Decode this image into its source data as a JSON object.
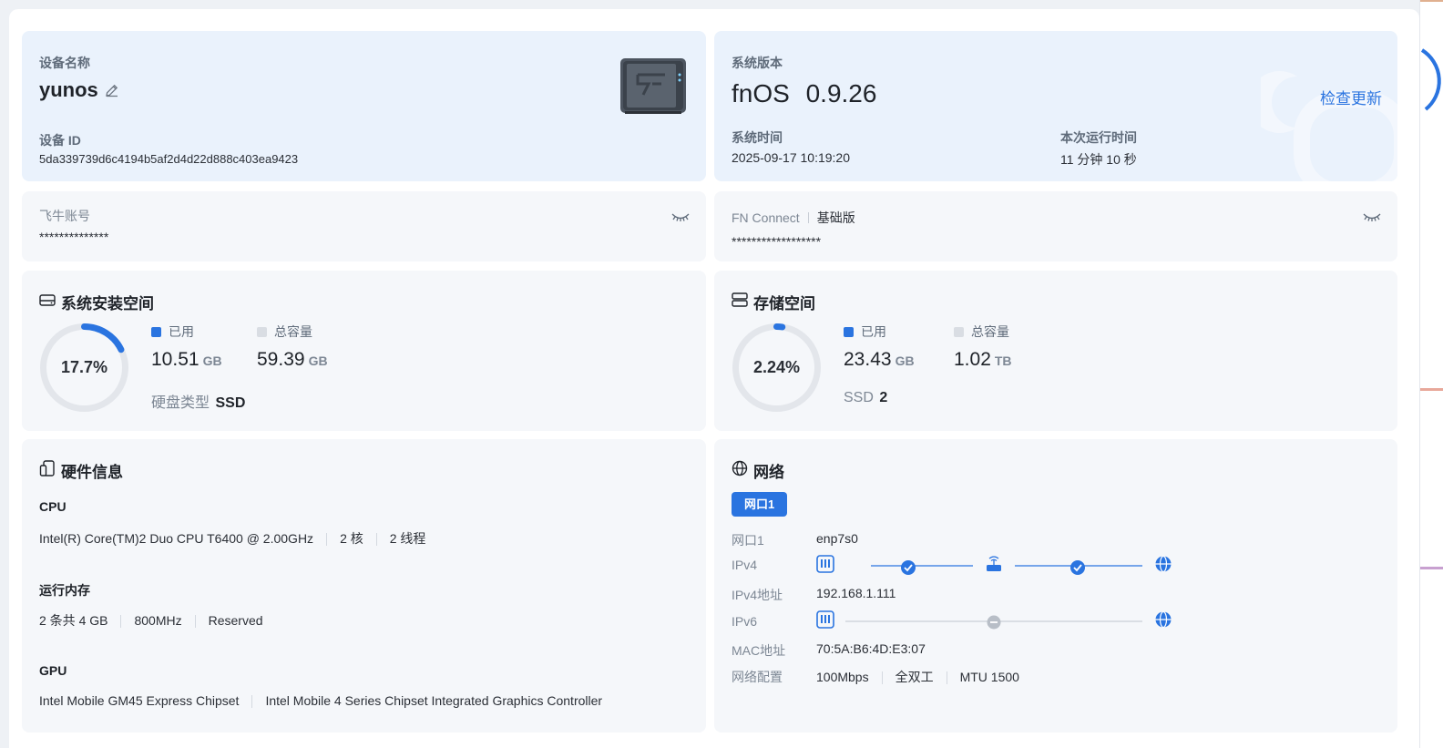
{
  "device": {
    "name_label": "设备名称",
    "name": "yunos",
    "id_label": "设备 ID",
    "id": "5da339739d6c4194b5af2d4d22d888c403ea9423"
  },
  "system": {
    "version_label": "系统版本",
    "os_name": "fnOS",
    "os_version": "0.9.26",
    "check_update": "检查更新",
    "time_label": "系统时间",
    "time": "2025-09-17 10:19:20",
    "uptime_label": "本次运行时间",
    "uptime": "11 分钟 10 秒"
  },
  "account": {
    "label": "飞牛账号",
    "value": "**************"
  },
  "fnconnect": {
    "label": "FN Connect",
    "tier": "基础版",
    "value": "******************"
  },
  "sys_storage": {
    "title": "系统安装空间",
    "percent_text": "17.7%",
    "percent": 17.7,
    "used_label": "已用",
    "used_value": "10.51",
    "used_unit": "GB",
    "total_label": "总容量",
    "total_value": "59.39",
    "total_unit": "GB",
    "disk_type_label": "硬盘类型",
    "disk_type": "SSD"
  },
  "storage": {
    "title": "存储空间",
    "percent_text": "2.24%",
    "percent": 2.24,
    "used_label": "已用",
    "used_value": "23.43",
    "used_unit": "GB",
    "total_label": "总容量",
    "total_value": "1.02",
    "total_unit": "TB",
    "ssd_label": "SSD",
    "ssd_count": "2"
  },
  "hardware": {
    "title": "硬件信息",
    "cpu_label": "CPU",
    "cpu_model": "Intel(R) Core(TM)2 Duo CPU T6400 @ 2.00GHz",
    "cpu_cores": "2 核",
    "cpu_threads": "2 线程",
    "mem_label": "运行内存",
    "mem_count": "2 条共 4 GB",
    "mem_freq": "800MHz",
    "mem_extra": "Reserved",
    "gpu_label": "GPU",
    "gpu_1": "Intel Mobile GM45 Express Chipset",
    "gpu_2": "Intel Mobile 4 Series Chipset Integrated Graphics Controller"
  },
  "network": {
    "title": "网络",
    "tab": "网口1",
    "port_label": "网口1",
    "port_value": "enp7s0",
    "ipv4_label": "IPv4",
    "ipv4_addr_label": "IPv4地址",
    "ipv4_addr": "192.168.1.111",
    "ipv6_label": "IPv6",
    "mac_label": "MAC地址",
    "mac": "70:5A:B6:4D:E3:07",
    "config_label": "网络配置",
    "speed": "100Mbps",
    "duplex": "全双工",
    "mtu": "MTU 1500"
  },
  "colors": {
    "accent": "#2a74e0",
    "ring_track": "#e3e6eb",
    "total_dot": "#d9dde3"
  }
}
